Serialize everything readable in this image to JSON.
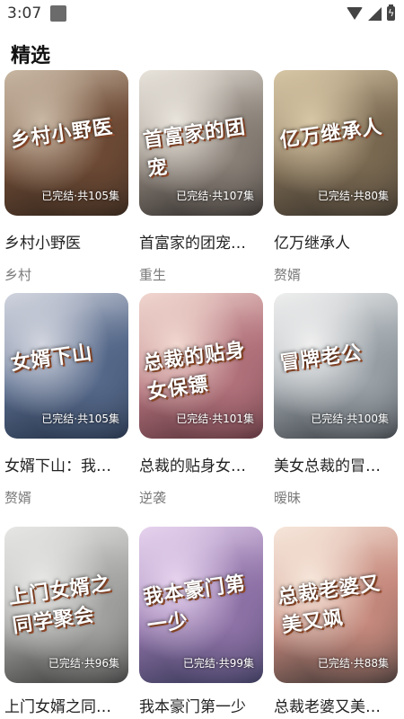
{
  "status_bar": {
    "time": "3:07"
  },
  "section": {
    "title": "精选"
  },
  "cards": [
    {
      "title": "乡村小野医",
      "cover_text": "乡村小野医",
      "badge": "已完结·共105集",
      "tag": "乡村",
      "colors": [
        "#c9b8a4",
        "#6d4a35",
        "#2a2018"
      ]
    },
    {
      "title": "首富家的团宠…",
      "cover_text": "首富家的团宠",
      "badge": "已完结·共107集",
      "tag": "重生",
      "colors": [
        "#e9e4dc",
        "#8a8178",
        "#262221"
      ]
    },
    {
      "title": "亿万继承人",
      "cover_text": "亿万继承人",
      "badge": "已完结·共80集",
      "tag": "赘婿",
      "colors": [
        "#d8c7a6",
        "#7b6a52",
        "#2f2a25"
      ]
    },
    {
      "title": "女婿下山：我…",
      "cover_text": "女婿下山",
      "badge": "已完结·共105集",
      "tag": "赘婿",
      "colors": [
        "#d2d5df",
        "#56698a",
        "#1e2a3d"
      ]
    },
    {
      "title": "总裁的贴身女…",
      "cover_text": "总裁的贴身女保镖",
      "badge": "已完结·共101集",
      "tag": "逆袭",
      "colors": [
        "#f1d7cf",
        "#b2727c",
        "#4d2a31"
      ]
    },
    {
      "title": "美女总裁的冒…",
      "cover_text": "冒牌老公",
      "badge": "已完结·共100集",
      "tag": "暧昧",
      "colors": [
        "#efefef",
        "#9aa2a8",
        "#2f3338"
      ]
    },
    {
      "title": "上门女婿之同…",
      "cover_text": "上门女婿之同学聚会",
      "badge": "已完结·共96集",
      "tag": "",
      "colors": [
        "#e7e7e5",
        "#a3a3a1",
        "#2d2d2d"
      ]
    },
    {
      "title": "我本豪门第一少",
      "cover_text": "我本豪门第一少",
      "badge": "已完结·共99集",
      "tag": "",
      "colors": [
        "#e7d3ef",
        "#8f73a8",
        "#2a2f4a"
      ]
    },
    {
      "title": "总裁老婆又美…",
      "cover_text": "总裁老婆又美又飒",
      "badge": "已完结·共88集",
      "tag": "",
      "colors": [
        "#f7e7db",
        "#c78a7e",
        "#2c2a29"
      ]
    }
  ]
}
